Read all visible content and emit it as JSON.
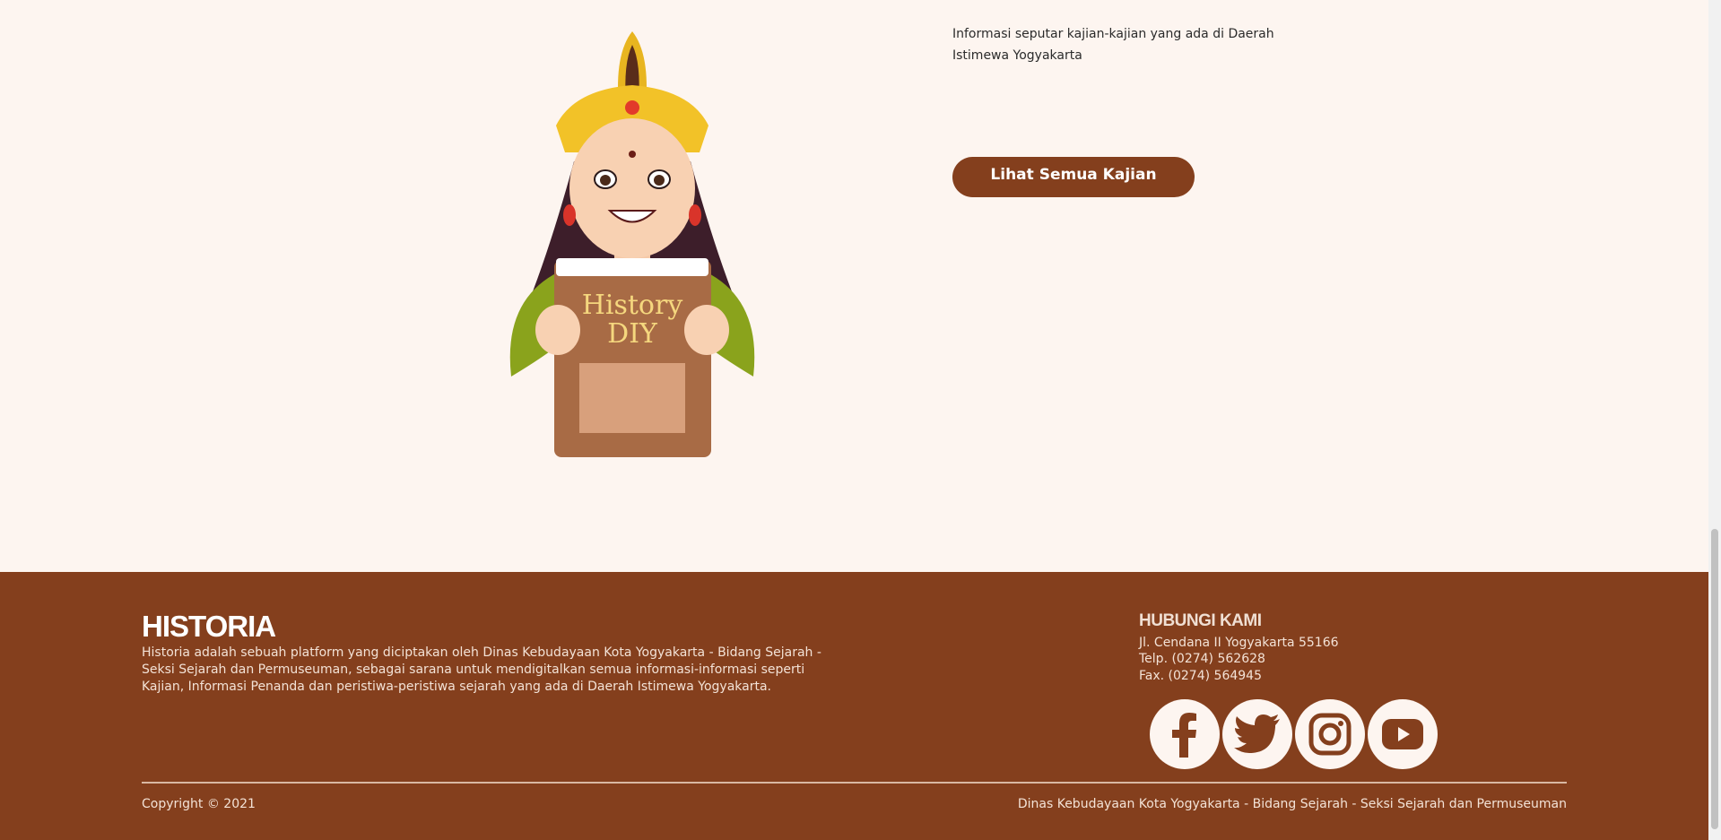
{
  "hero": {
    "description": "Informasi seputar kajian-kajian yang ada di Daerah Istimewa Yogyakarta",
    "book_line1": "History",
    "book_line2": "DIY",
    "cta_label": "Lihat Semua Kajian"
  },
  "footer": {
    "brand": "HISTORIA",
    "about": "Historia adalah sebuah platform yang diciptakan oleh Dinas Kebudayaan Kota Yogyakarta - Bidang Sejarah - Seksi Sejarah dan Permuseuman, sebagai sarana untuk mendigitalkan semua informasi-informasi seperti Kajian, Informasi Penanda dan peristiwa-peristiwa sejarah yang ada di Daerah Istimewa Yogyakarta.",
    "contact": {
      "title": "HUBUNGI KAMI",
      "address": "Jl. Cendana II Yogyakarta 55166",
      "phone": "Telp. (0274) 562628",
      "fax": "Fax. (0274) 564945"
    },
    "socials": [
      "facebook-icon",
      "twitter-icon",
      "instagram-icon",
      "youtube-icon"
    ],
    "copyright": "Copyright © 2021",
    "credit": "Dinas Kebudayaan Kota Yogyakarta - Bidang Sejarah - Seksi Sejarah dan Permuseuman"
  },
  "colors": {
    "background": "#fdf5f0",
    "brand_brown": "#843f1d",
    "text": "#2b2b2b"
  }
}
